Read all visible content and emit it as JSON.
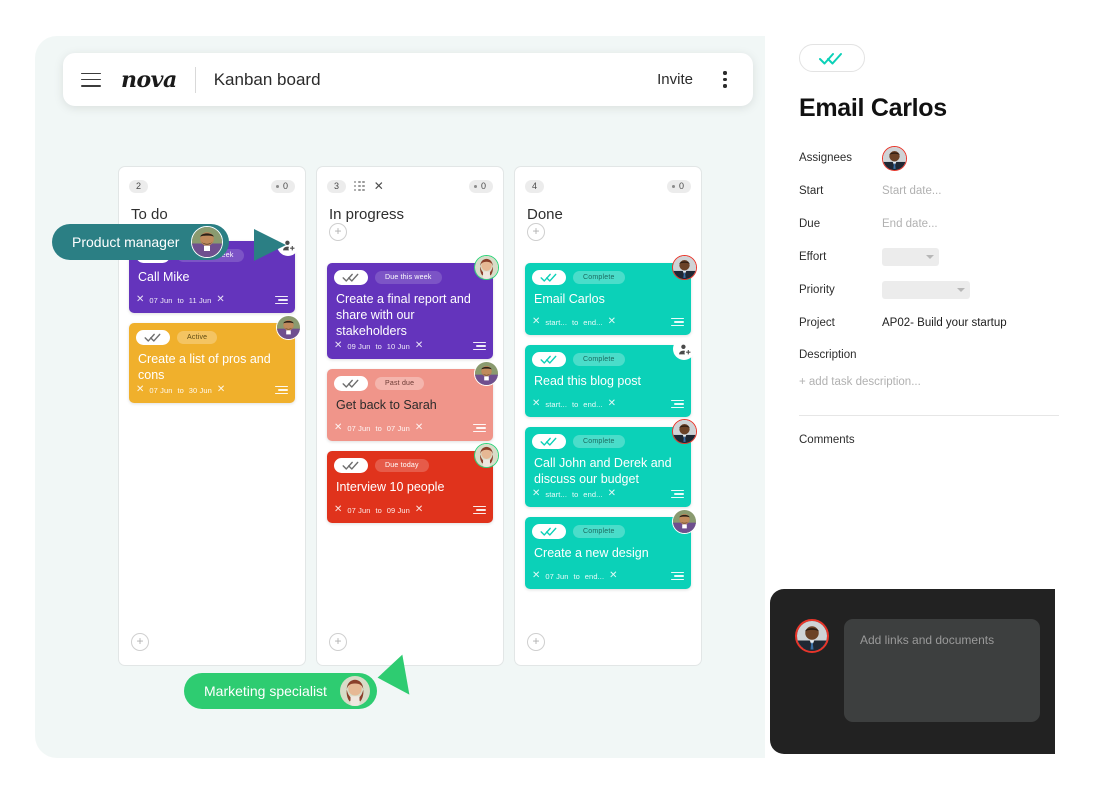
{
  "topbar": {
    "brand": "nova",
    "board_title": "Kanban board",
    "invite_label": "Invite",
    "menu_icon": "hamburger-icon",
    "more_icon": "kebab-menu-icon"
  },
  "columns": [
    {
      "name": "To do",
      "count": "2",
      "dot_count": "0",
      "has_grip": false,
      "cards": [
        {
          "title": "Call Mike",
          "status": "Due this week",
          "color": "#6434bc",
          "status_bg": "rgba(255,255,255,0.16)",
          "status_color": "#ffffff",
          "check_color": "#6e6e6e",
          "start": "07 Jun",
          "to": "to",
          "end": "11 Jun",
          "assignee": "add-person-icon"
        },
        {
          "title": "Create a list of pros and cons",
          "status": "Active",
          "color": "#f0b02c",
          "status_bg": "rgba(255,255,255,0.26)",
          "status_color": "#5e4a12",
          "check_color": "#6e6e6e",
          "start": "07 Jun",
          "to": "to",
          "end": "30 Jun",
          "assignee": "avatar-male-beard"
        }
      ]
    },
    {
      "name": "In progress",
      "count": "3",
      "dot_count": "0",
      "has_grip": true,
      "close_icon": "close-icon",
      "cards": [
        {
          "title": "Create a final report and share with our stakeholders",
          "status": "Due this week",
          "color": "#6434bc",
          "status_bg": "rgba(255,255,255,0.16)",
          "status_color": "#ffffff",
          "check_color": "#6e6e6e",
          "start": "09 Jun",
          "to": "to",
          "end": "10 Jun",
          "assignee": "avatar-female-redhair"
        },
        {
          "title": "Get back to Sarah",
          "status": "Past due",
          "color": "#f0958a",
          "status_bg": "rgba(255,255,255,0.30)",
          "status_color": "#6b3a34",
          "check_color": "#6e6e6e",
          "start": "07 Jun",
          "to": "to",
          "end": "07 Jun",
          "assignee": "avatar-male-beard"
        },
        {
          "title": "Interview 10 people",
          "status": "Due today",
          "color": "#e0331c",
          "status_bg": "rgba(255,255,255,0.20)",
          "status_color": "#ffffff",
          "check_color": "#6e6e6e",
          "start": "07 Jun",
          "to": "to",
          "end": "09 Jun",
          "assignee": "avatar-female-redhair"
        }
      ]
    },
    {
      "name": "Done",
      "count": "4",
      "dot_count": "0",
      "has_grip": false,
      "cards": [
        {
          "title": "Email Carlos",
          "status": "Complete",
          "color": "#0bd1b8",
          "status_bg": "rgba(255,255,255,0.26)",
          "status_color": "#1b6b60",
          "check_color": "#0bd1b8",
          "start": "start...",
          "to": "to",
          "end": "end...",
          "assignee": "avatar-male-suit"
        },
        {
          "title": "Read this blog post",
          "status": "Complete",
          "color": "#0bd1b8",
          "status_bg": "rgba(255,255,255,0.26)",
          "status_color": "#1b6b60",
          "check_color": "#0bd1b8",
          "start": "start...",
          "to": "to",
          "end": "end...",
          "assignee": "add-person-icon"
        },
        {
          "title": "Call John and Derek  and discuss our budget",
          "status": "Complete",
          "color": "#0bd1b8",
          "status_bg": "rgba(255,255,255,0.26)",
          "status_color": "#1b6b60",
          "check_color": "#0bd1b8",
          "start": "start...",
          "to": "to",
          "end": "end...",
          "assignee": "avatar-male-suit"
        },
        {
          "title": "Create a new design",
          "status": "Complete",
          "color": "#0bd1b8",
          "status_bg": "rgba(255,255,255,0.26)",
          "status_color": "#1b6b60",
          "check_color": "#0bd1b8",
          "start": "07 Jun",
          "to": "to",
          "end": "end...",
          "assignee": "avatar-male-beard"
        }
      ]
    }
  ],
  "callouts": [
    {
      "label": "Product manager",
      "color": "#2b7f84",
      "avatar": "avatar-male-beard"
    },
    {
      "label": "Marketing specialist",
      "color": "#2ecc71",
      "avatar": "avatar-female-redhair"
    }
  ],
  "detail": {
    "title": "Email Carlos",
    "check_icon": "double-check-icon",
    "assignees_label": "Assignees",
    "assignee_avatar": "avatar-male-suit",
    "start_label": "Start",
    "start_placeholder": "Start date...",
    "due_label": "Due",
    "due_placeholder": "End date...",
    "effort_label": "Effort",
    "effort_value": "",
    "priority_label": "Priority",
    "priority_value": "",
    "project_label": "Project",
    "project_value": "AP02- Build your startup",
    "description_label": "Description",
    "description_placeholder": "+ add task description...",
    "comments_label": "Comments"
  },
  "composer": {
    "placeholder": "Add links and documents",
    "avatar": "avatar-male-suit"
  },
  "colors": {
    "board_bg": "#f1f7f6",
    "purple": "#6434bc",
    "orange": "#f0b02c",
    "salmon": "#f0958a",
    "red": "#e0331c",
    "teal": "#0bd1b8",
    "callout_teal": "#2b7f84",
    "callout_green": "#2ecc71",
    "composer_bg": "#222222"
  }
}
